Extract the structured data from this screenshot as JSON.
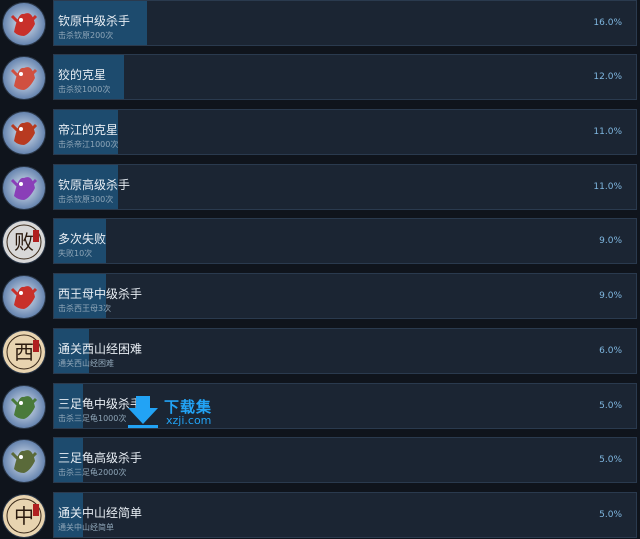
{
  "achievements": [
    {
      "name": "钦原中级杀手",
      "desc": "击杀钦原200次",
      "percent": "16.0%",
      "fill": 0.16,
      "icon": "red-bird-creature-icon",
      "accent": "#c8302a"
    },
    {
      "name": "狡的克星",
      "desc": "击杀狡1000次",
      "percent": "12.0%",
      "fill": 0.12,
      "icon": "white-red-beast-icon",
      "accent": "#d05040"
    },
    {
      "name": "帝江的克星",
      "desc": "击杀帝江1000次",
      "percent": "11.0%",
      "fill": 0.11,
      "icon": "red-creature-icon",
      "accent": "#b83a20"
    },
    {
      "name": "钦原高级杀手",
      "desc": "击杀钦原300次",
      "percent": "11.0%",
      "fill": 0.11,
      "icon": "purple-bird-creature-icon",
      "accent": "#8a3fb8"
    },
    {
      "name": "多次失败",
      "desc": "失败10次",
      "percent": "9.0%",
      "fill": 0.09,
      "icon": "failure-glyph-icon",
      "accent": "#d8d8d8",
      "glyph": "败"
    },
    {
      "name": "西王母中级杀手",
      "desc": "击杀西王母3次",
      "percent": "9.0%",
      "fill": 0.09,
      "icon": "queen-mother-icon",
      "accent": "#c8302a"
    },
    {
      "name": "通关西山经困难",
      "desc": "通关西山经困难",
      "percent": "6.0%",
      "fill": 0.06,
      "icon": "west-glyph-icon",
      "accent": "#e8d4b0",
      "glyph": "西"
    },
    {
      "name": "三足龟中级杀手",
      "desc": "击杀三足龟1000次",
      "percent": "5.0%",
      "fill": 0.05,
      "icon": "three-legged-turtle-icon",
      "accent": "#4a7a3a"
    },
    {
      "name": "三足龟高级杀手",
      "desc": "击杀三足龟2000次",
      "percent": "5.0%",
      "fill": 0.05,
      "icon": "green-turtle-icon",
      "accent": "#5a6a3a"
    },
    {
      "name": "通关中山经简单",
      "desc": "通关中山经简单",
      "percent": "5.0%",
      "fill": 0.05,
      "icon": "middle-glyph-icon",
      "accent": "#e8d4b0",
      "glyph": "中"
    }
  ],
  "watermark": {
    "title": "下载集",
    "sub": "xzji.com"
  }
}
